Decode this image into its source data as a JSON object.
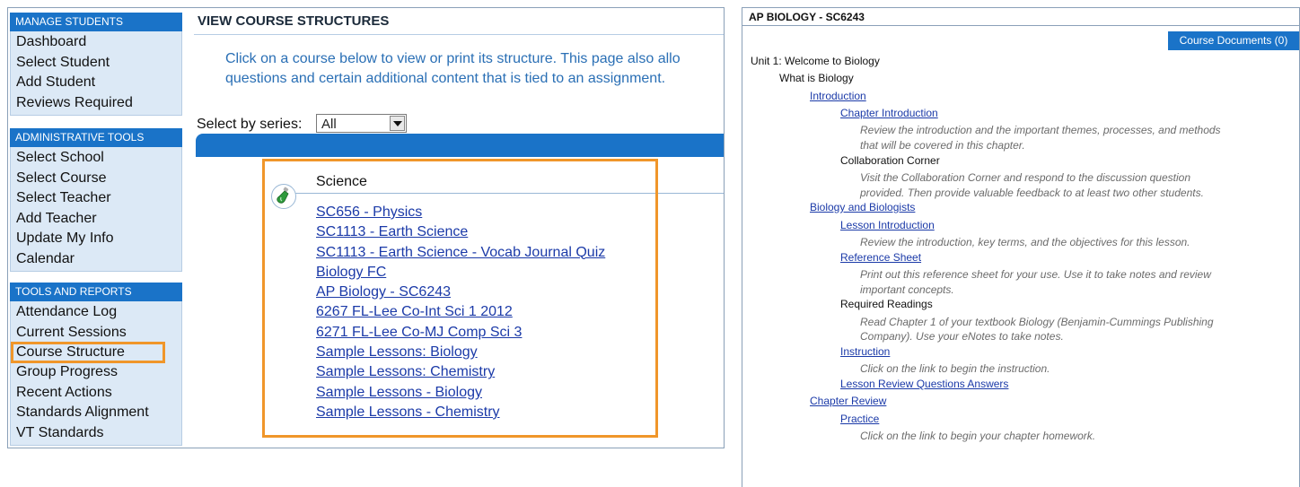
{
  "sidebar": {
    "sections": [
      {
        "title": "MANAGE STUDENTS",
        "items": [
          "Dashboard",
          "Select Student",
          "Add Student",
          "Reviews Required"
        ]
      },
      {
        "title": "ADMINISTRATIVE TOOLS",
        "items": [
          "Select School",
          "Select Course",
          "Select Teacher",
          "Add Teacher",
          "Update My Info",
          "Calendar"
        ]
      },
      {
        "title": "TOOLS AND REPORTS",
        "items": [
          "Attendance Log",
          "Current Sessions",
          "Course Structure",
          "Group Progress",
          "Recent Actions",
          "Standards Alignment",
          "VT Standards"
        ]
      }
    ]
  },
  "main": {
    "title": "VIEW COURSE STRUCTURES",
    "description_line1": "Click on a course below to view or print its structure. This page also allo",
    "description_line2": "questions and certain additional content that is tied to an assignment.",
    "series_label": "Select by series:",
    "series_value": "All",
    "category": "Science",
    "courses": [
      "SC656 - Physics",
      "SC1113 - Earth Science",
      "SC1113 - Earth Science - Vocab Journal Quiz",
      "Biology FC",
      "AP Biology - SC6243",
      "6267 FL-Lee Co-Int Sci 1 2012",
      "6271 FL-Lee Co-MJ Comp Sci 3",
      "Sample Lessons: Biology",
      "Sample Lessons: Chemistry",
      "Sample Lessons - Biology",
      "Sample Lessons - Chemistry"
    ]
  },
  "right": {
    "title": "AP BIOLOGY - SC6243",
    "docs_tab": "Course Documents (0)",
    "outline": [
      {
        "text": "Unit 1: Welcome to Biology",
        "style": "plain",
        "level": 0
      },
      {
        "text": "What is Biology",
        "style": "plain",
        "level": 1
      },
      {
        "text": "Introduction",
        "style": "link",
        "level": 2
      },
      {
        "text": "Chapter Introduction",
        "style": "link",
        "level": 3
      },
      {
        "text": "Review the introduction and the important themes, processes, and methods",
        "style": "desc",
        "level": 4
      },
      {
        "text": "that will be covered in this chapter.",
        "style": "desc",
        "level": 4
      },
      {
        "text": "Collaboration Corner",
        "style": "plain",
        "level": 3
      },
      {
        "text": "Visit the Collaboration Corner and respond to the discussion question",
        "style": "desc",
        "level": 4
      },
      {
        "text": "provided. Then provide valuable feedback to at least two other students.",
        "style": "desc",
        "level": 4
      },
      {
        "text": "Biology and Biologists",
        "style": "link",
        "level": 2
      },
      {
        "text": "Lesson Introduction",
        "style": "link",
        "level": 3
      },
      {
        "text": "Review the introduction, key terms, and the objectives for this lesson.",
        "style": "desc",
        "level": 4
      },
      {
        "text": "Reference Sheet",
        "style": "link",
        "level": 3
      },
      {
        "text": "Print out this reference sheet for your use. Use it to take notes and review",
        "style": "desc",
        "level": 4
      },
      {
        "text": "important concepts.",
        "style": "desc",
        "level": 4
      },
      {
        "text": "Required Readings",
        "style": "plain",
        "level": 3
      },
      {
        "text": "Read Chapter 1 of your textbook Biology (Benjamin-Cummings Publishing",
        "style": "desc",
        "level": 4
      },
      {
        "text": "Company). Use your eNotes to take notes.",
        "style": "desc",
        "level": 4
      },
      {
        "text": "Instruction",
        "style": "link",
        "level": 3
      },
      {
        "text": "Click on the link to begin the instruction.",
        "style": "desc",
        "level": 4
      },
      {
        "text": "Lesson Review Questions Answers",
        "style": "link",
        "level": 3
      },
      {
        "text": "Chapter Review",
        "style": "link",
        "level": 2
      },
      {
        "text": "Practice",
        "style": "link",
        "level": 3
      },
      {
        "text": "Click on the link to begin your chapter homework.",
        "style": "desc",
        "level": 4
      }
    ]
  }
}
